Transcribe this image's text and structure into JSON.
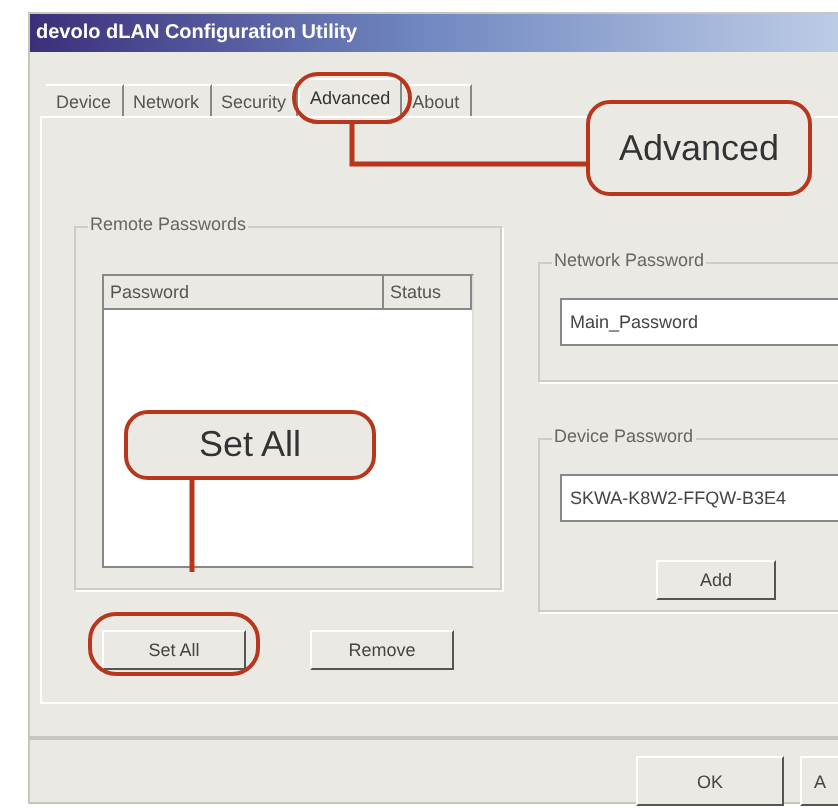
{
  "window": {
    "title": "devolo dLAN Configuration Utility"
  },
  "tabs": [
    {
      "label": "Device",
      "selected": false
    },
    {
      "label": "Network",
      "selected": false
    },
    {
      "label": "Security",
      "selected": false
    },
    {
      "label": "Advanced",
      "selected": true
    },
    {
      "label": "About",
      "selected": false
    }
  ],
  "remote_passwords": {
    "title": "Remote Passwords",
    "columns": [
      "Password",
      "Status"
    ],
    "buttons": [
      "Set All",
      "Remove"
    ]
  },
  "network_password": {
    "title": "Network Password",
    "value": "Main_Password"
  },
  "device_password": {
    "title": "Device Password",
    "value": "SKWA-K8W2-FFQW-B3E4",
    "button": "Add"
  },
  "footer_buttons": [
    "OK",
    "A"
  ],
  "callouts": [
    {
      "text": "Advanced",
      "kind": "tab"
    },
    {
      "text": "Set All",
      "kind": "button"
    }
  ]
}
